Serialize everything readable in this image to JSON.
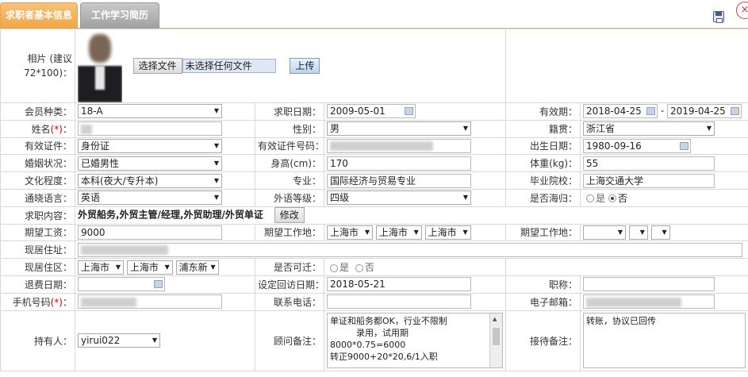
{
  "tabs": [
    {
      "label": "求职者基本信息"
    },
    {
      "label": "工作学习简历"
    }
  ],
  "icons": {
    "save": "save-icon",
    "close": "close-icon"
  },
  "photo": {
    "label": "相片 (建议72*100)：",
    "choose_file": "选择文件",
    "no_file": "未选择任何文件",
    "upload": "上传"
  },
  "row1": {
    "member_type_label": "会员种类：",
    "member_type_value": "18-A",
    "apply_date_label": "求职日期：",
    "apply_date_value": "2009-05-01",
    "valid_label": "有效期：",
    "valid_from": "2018-04-25",
    "valid_sep": "-",
    "valid_to": "2019-04-25"
  },
  "row2": {
    "name_label": "姓名",
    "req": "(*)",
    "colon": "：",
    "gender_label": "性别：",
    "gender_value": "男",
    "origin_label": "籍贯：",
    "origin_value": "浙江省"
  },
  "row3": {
    "id_type_label": "有效证件：",
    "id_type_value": "身份证",
    "id_no_label": "有效证件号码：",
    "birth_label": "出生日期：",
    "birth_value": "1980-09-16"
  },
  "row4": {
    "marital_label": "婚姻状况：",
    "marital_value": "已婚男性",
    "height_label": "身高(cm)：",
    "height_value": "170",
    "weight_label": "体重(kg)：",
    "weight_value": "55"
  },
  "row5": {
    "edu_label": "文化程度：",
    "edu_value": "本科(夜大/专升本)",
    "major_label": "专业：",
    "major_value": "国际经济与贸易专业",
    "school_label": "毕业院校：",
    "school_value": "上海交通大学"
  },
  "row6": {
    "lang_label": "通晓语言：",
    "lang_value": "英语",
    "lang_level_label": "外语等级：",
    "lang_level_value": "四级",
    "returnee_label": "是否海归：",
    "yes": "是",
    "no": "否"
  },
  "row7": {
    "job_label": "求职内容：",
    "job_value": "外贸船务,外贸主管/经理,外贸助理/外贸单证",
    "edit": "修改"
  },
  "row8": {
    "salary_label": "期望工资：",
    "salary_value": "9000",
    "loc_label": "期望工作地：",
    "loc1": "上海市",
    "loc2": "上海市",
    "loc3": "上海市",
    "loc_label2": "期望工作地："
  },
  "row9": {
    "address_label": "现居住址："
  },
  "row10": {
    "area_label": "现居住区：",
    "area1": "上海市",
    "area2": "上海市",
    "area3": "浦东新",
    "transfer_label": "是否可迁：",
    "yes": "是",
    "no": "否"
  },
  "row11": {
    "refund_label": "退费日期：",
    "visit_label": "设定回访日期：",
    "visit_value": "2018-05-21",
    "title_label": "职称："
  },
  "row12": {
    "phone_label": "手机号码",
    "req": "(*)",
    "colon": "：",
    "tel_label": "联系电话：",
    "email_label": "电子邮箱："
  },
  "row13": {
    "holder_label": "持有人：",
    "holder_value": "yirui022",
    "advisor_label": "顾问备注：",
    "advisor_note": "单证和船务都OK，行业不限制\n　　　录用，试用期\n8000*0.75=6000\n转正9000+20*20,6/1入职",
    "reception_label": "接待备注：",
    "reception_note": "转账，协议已回传"
  }
}
